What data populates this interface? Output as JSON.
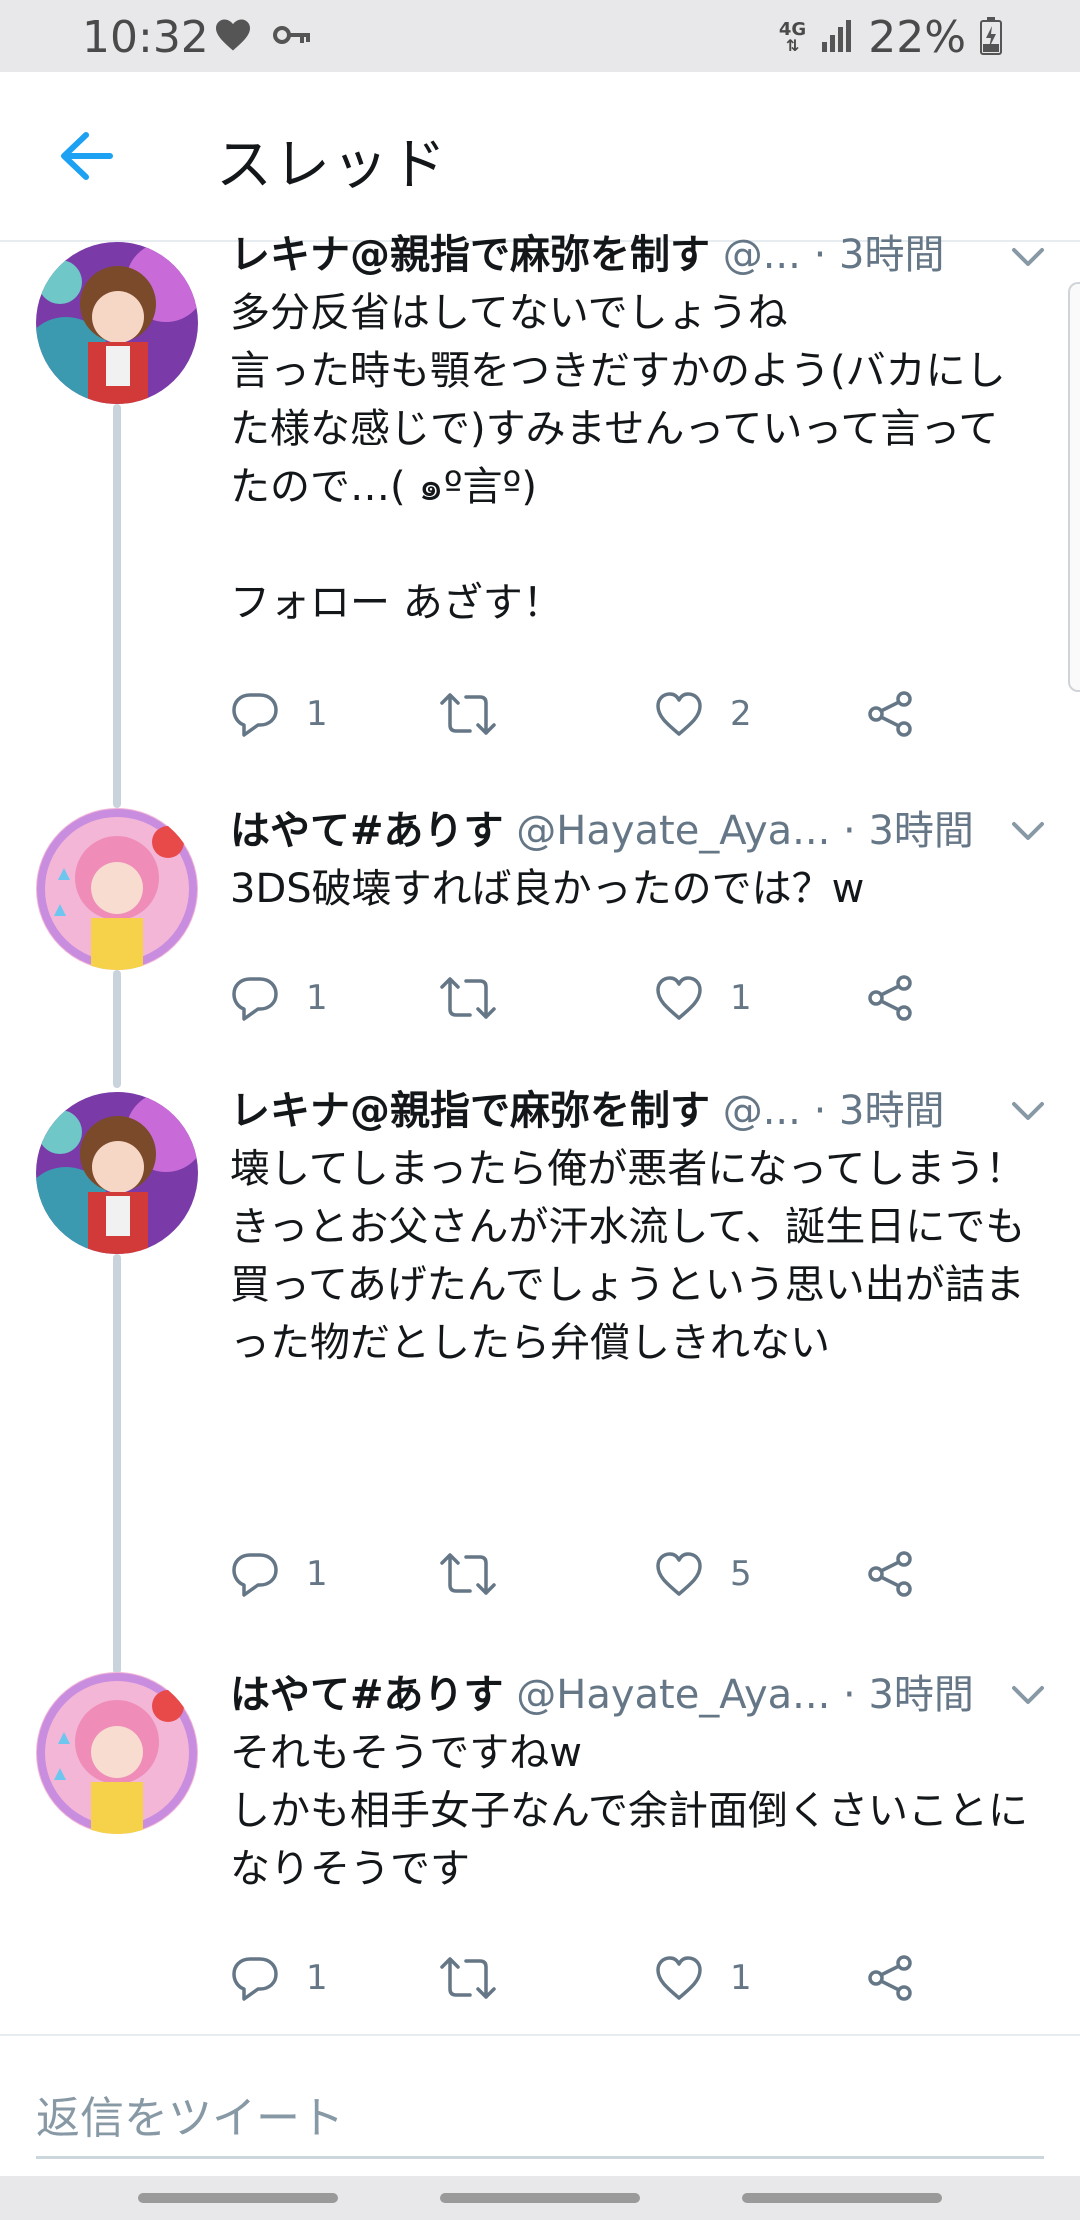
{
  "status_bar": {
    "time": "10:32",
    "network": "4G",
    "battery": "22%",
    "icons": [
      "heart-icon",
      "key-icon",
      "signal-icon",
      "battery-charging-icon"
    ]
  },
  "header": {
    "title": "スレッド",
    "back_icon": "arrow-left-icon",
    "accent_color": "#1da1f2"
  },
  "tweets": [
    {
      "name": "レキナ@親指で麻弥を制す",
      "handle": "@...",
      "time": "3時間",
      "text": "多分反省はしてないでしょうね\n言った時も顎をつきだすかのよう(バカにした様な感じで)すみませんっていって言ってたので…( ๑º言º)\n\nフォロー あざす！",
      "replies": "1",
      "retweets": "",
      "likes": "2"
    },
    {
      "name": "はやて#ありす",
      "handle": "@Hayate_Aya...",
      "time": "3時間",
      "text": "3DS破壊すれば良かったのでは？w",
      "replies": "1",
      "retweets": "",
      "likes": "1"
    },
    {
      "name": "レキナ@親指で麻弥を制す",
      "handle": "@...",
      "time": "3時間",
      "text": "壊してしまったら俺が悪者になってしまう！\nきっとお父さんが汗水流して、誕生日にでも買ってあげたんでしょうという思い出が詰まった物だとしたら弁償しきれない",
      "replies": "1",
      "retweets": "",
      "likes": "5"
    },
    {
      "name": "はやて#ありす",
      "handle": "@Hayate_Aya...",
      "time": "3時間",
      "text": "それもそうですねw\nしかも相手女子なんで余計面倒くさいことになりそうです",
      "replies": "1",
      "retweets": "",
      "likes": "1"
    }
  ],
  "reply_bar": {
    "placeholder": "返信をツイート"
  },
  "separator": "·"
}
